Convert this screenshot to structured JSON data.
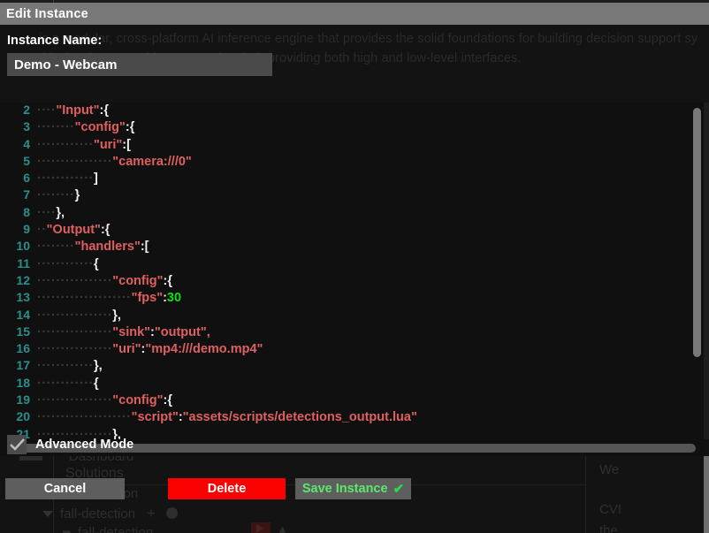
{
  "background": {
    "description_line1": "is a modular, cross-platform AI inference engine that provides the solid foundations for building decision support sy",
    "description_line2": "up with developers and integrators in mind, providing both high and low-level interfaces.",
    "nav": {
      "dashboard": "Dashboard",
      "solutions": "Solutions",
      "detection_partial": "tion",
      "fall_detection": "fall-detection",
      "fall_detection_child": "fall-detection",
      "plus_icon": "plus-icon",
      "info_icon": "info-icon"
    },
    "right_column": {
      "line1": "We",
      "line2": "CVI",
      "line3": "the"
    }
  },
  "dialog": {
    "title": "Edit Instance",
    "instance_name": {
      "label": "Instance Name:",
      "value": "Demo - Webcam",
      "placeholder": "Instance Name"
    },
    "advanced_mode": {
      "label": "Advanced Mode",
      "checked": true
    },
    "buttons": {
      "cancel": "Cancel",
      "delete": "Delete",
      "save": "Save Instance",
      "save_check_icon": "check-icon"
    }
  },
  "editor": {
    "first_visible_line": 2,
    "lines": [
      {
        "no": "2",
        "segments": [
          {
            "t": "ind",
            "v": "····"
          },
          {
            "t": "key",
            "v": "\"Input\""
          },
          {
            "t": "punct",
            "v": ":"
          },
          {
            "t": "punct",
            "v": "{"
          }
        ]
      },
      {
        "no": "3",
        "segments": [
          {
            "t": "ind",
            "v": "········"
          },
          {
            "t": "key",
            "v": "\"config\""
          },
          {
            "t": "punct",
            "v": ":"
          },
          {
            "t": "punct",
            "v": "{"
          }
        ]
      },
      {
        "no": "4",
        "segments": [
          {
            "t": "ind",
            "v": "············"
          },
          {
            "t": "key",
            "v": "\"uri\""
          },
          {
            "t": "punct",
            "v": ":"
          },
          {
            "t": "punct",
            "v": "["
          }
        ]
      },
      {
        "no": "5",
        "segments": [
          {
            "t": "ind",
            "v": "················"
          },
          {
            "t": "str",
            "v": "\"camera:///0\""
          }
        ]
      },
      {
        "no": "6",
        "segments": [
          {
            "t": "ind",
            "v": "············"
          },
          {
            "t": "punct",
            "v": "]"
          }
        ]
      },
      {
        "no": "7",
        "segments": [
          {
            "t": "ind",
            "v": "········"
          },
          {
            "t": "punct",
            "v": "}"
          }
        ]
      },
      {
        "no": "8",
        "segments": [
          {
            "t": "ind",
            "v": "····"
          },
          {
            "t": "punct",
            "v": "},"
          }
        ]
      },
      {
        "no": "9",
        "segments": [
          {
            "t": "ind",
            "v": "··"
          },
          {
            "t": "key",
            "v": "\"Output\""
          },
          {
            "t": "punct",
            "v": ":"
          },
          {
            "t": "punct",
            "v": "{"
          }
        ]
      },
      {
        "no": "10",
        "segments": [
          {
            "t": "ind",
            "v": "········"
          },
          {
            "t": "key",
            "v": "\"handlers\""
          },
          {
            "t": "punct",
            "v": ":"
          },
          {
            "t": "punct",
            "v": "["
          }
        ]
      },
      {
        "no": "11",
        "segments": [
          {
            "t": "ind",
            "v": "············"
          },
          {
            "t": "punct",
            "v": "{"
          }
        ]
      },
      {
        "no": "12",
        "segments": [
          {
            "t": "ind",
            "v": "················"
          },
          {
            "t": "key",
            "v": "\"config\""
          },
          {
            "t": "punct",
            "v": ":"
          },
          {
            "t": "punct",
            "v": "{"
          }
        ]
      },
      {
        "no": "13",
        "segments": [
          {
            "t": "ind",
            "v": "····················"
          },
          {
            "t": "key",
            "v": "\"fps\""
          },
          {
            "t": "punct",
            "v": ":"
          },
          {
            "t": "num",
            "v": "30"
          }
        ]
      },
      {
        "no": "14",
        "segments": [
          {
            "t": "ind",
            "v": "················"
          },
          {
            "t": "punct",
            "v": "},"
          }
        ]
      },
      {
        "no": "15",
        "segments": [
          {
            "t": "ind",
            "v": "················"
          },
          {
            "t": "key",
            "v": "\"sink\""
          },
          {
            "t": "punct",
            "v": ":"
          },
          {
            "t": "str",
            "v": "\"output\","
          }
        ]
      },
      {
        "no": "16",
        "segments": [
          {
            "t": "ind",
            "v": "················"
          },
          {
            "t": "key",
            "v": "\"uri\""
          },
          {
            "t": "punct",
            "v": ":"
          },
          {
            "t": "str",
            "v": "\"mp4:///demo.mp4\""
          }
        ]
      },
      {
        "no": "17",
        "segments": [
          {
            "t": "ind",
            "v": "············"
          },
          {
            "t": "punct",
            "v": "},"
          }
        ]
      },
      {
        "no": "18",
        "segments": [
          {
            "t": "ind",
            "v": "············"
          },
          {
            "t": "punct",
            "v": "{"
          }
        ]
      },
      {
        "no": "19",
        "segments": [
          {
            "t": "ind",
            "v": "················"
          },
          {
            "t": "key",
            "v": "\"config\""
          },
          {
            "t": "punct",
            "v": ":"
          },
          {
            "t": "punct",
            "v": "{"
          }
        ]
      },
      {
        "no": "20",
        "segments": [
          {
            "t": "ind",
            "v": "····················"
          },
          {
            "t": "key",
            "v": "\"script\""
          },
          {
            "t": "punct",
            "v": ":"
          },
          {
            "t": "str",
            "v": "\"assets/scripts/detections_output.lua\""
          }
        ]
      },
      {
        "no": "21",
        "segments": [
          {
            "t": "ind",
            "v": "················"
          },
          {
            "t": "punct",
            "v": "},"
          }
        ]
      }
    ]
  },
  "colors": {
    "titlebar": "#787878",
    "editor_bg": "#101010",
    "line_number": "#2a8f8f",
    "json_key": "#e0605f",
    "json_number": "#12e012",
    "delete_button": "#fb0000",
    "save_text": "#5de86a"
  }
}
